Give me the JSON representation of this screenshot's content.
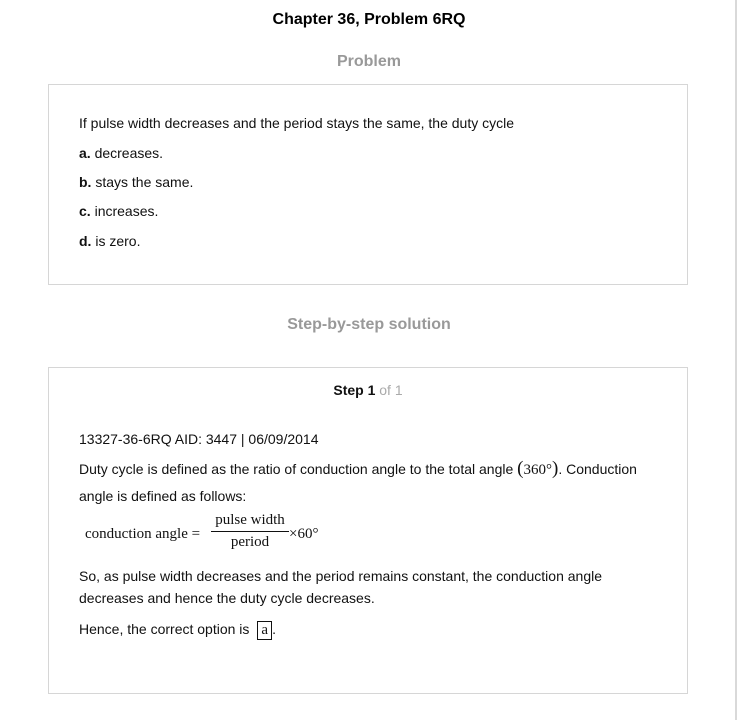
{
  "header": {
    "title": "Chapter 36, Problem 6RQ"
  },
  "problem": {
    "heading": "Problem",
    "question": "If pulse width decreases and the period stays the same, the duty cycle",
    "options": [
      {
        "letter": "a.",
        "text": " decreases."
      },
      {
        "letter": "b.",
        "text": " stays the same."
      },
      {
        "letter": "c.",
        "text": " increases."
      },
      {
        "letter": "d.",
        "text": " is zero."
      }
    ]
  },
  "solution": {
    "heading": "Step-by-step solution",
    "step_label": "Step 1",
    "step_of": " of 1",
    "id_line": "13327-36-6RQ AID: 3447 | 06/09/2014",
    "def_part1": "Duty cycle is defined as the ratio of conduction angle to the total angle ",
    "def_paren_open": "(",
    "def_angle": "360°",
    "def_paren_close": ")",
    "def_part2": ". Conduction",
    "def_line2": "angle is defined as follows:",
    "equation": {
      "lhs": "conduction angle =",
      "numerator": "pulse width",
      "denominator": "period",
      "rhs": "×60°"
    },
    "conclusion_line1": "So, as pulse width decreases and the period remains constant, the conduction angle",
    "conclusion_line2": "decreases and hence the duty cycle decreases.",
    "answer_prefix": "Hence, the correct option is",
    "answer_value": "a",
    "answer_suffix": "."
  }
}
